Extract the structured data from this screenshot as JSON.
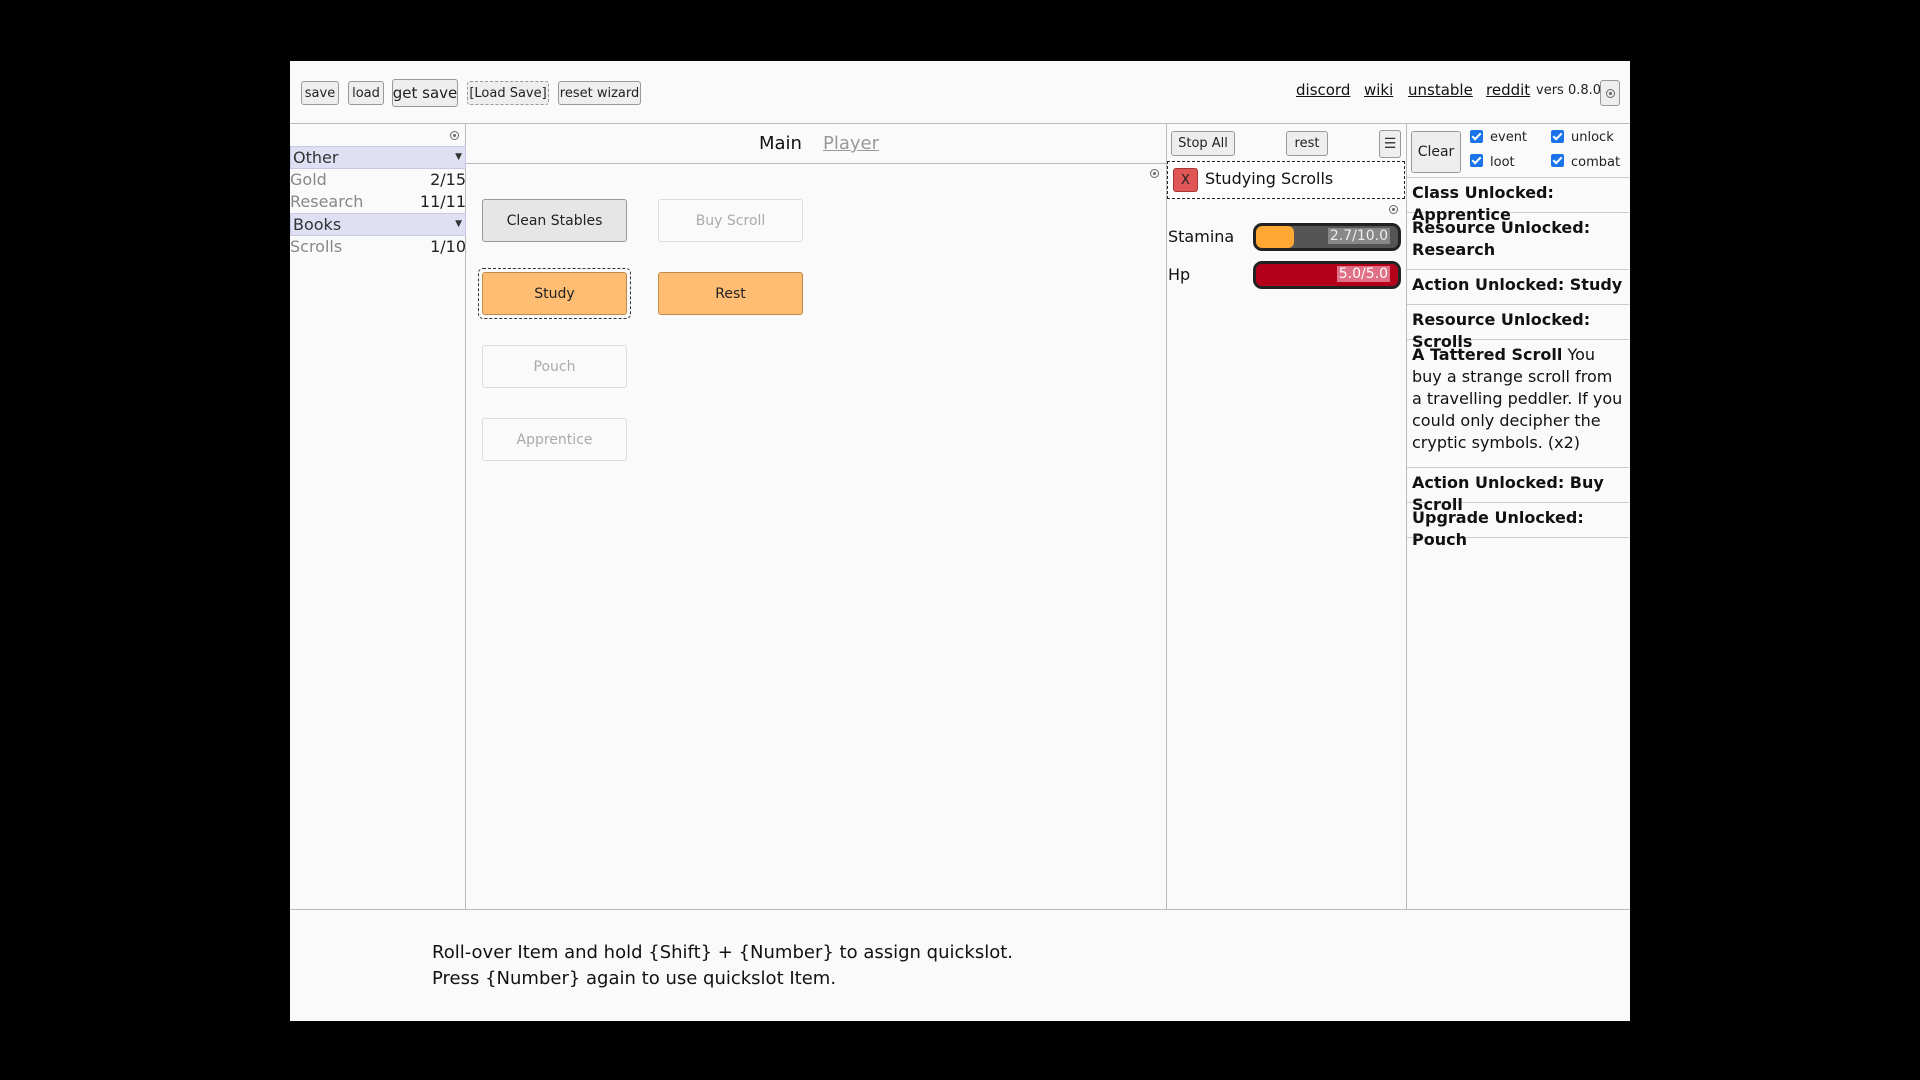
{
  "toolbar": {
    "save": "save",
    "load": "load",
    "get_save": "get save",
    "load_save": "[Load Save]",
    "reset_wizard": "reset wizard"
  },
  "links": {
    "discord": "discord",
    "wiki": "wiki",
    "unstable": "unstable",
    "reddit": "reddit",
    "version": "vers 0.8.0"
  },
  "resources": {
    "groups": [
      {
        "name": "Other",
        "items": [
          {
            "name": "Gold",
            "value": "2/15"
          },
          {
            "name": "Research",
            "value": "11/11"
          }
        ]
      },
      {
        "name": "Books",
        "items": [
          {
            "name": "Scrolls",
            "value": "1/10"
          }
        ]
      }
    ]
  },
  "tabs": {
    "main": "Main",
    "player": "Player"
  },
  "actions": {
    "clean_stables": "Clean Stables",
    "buy_scroll": "Buy Scroll",
    "study": "Study",
    "rest": "Rest",
    "pouch": "Pouch",
    "apprentice": "Apprentice"
  },
  "running": {
    "stop_all": "Stop All",
    "rest": "rest",
    "cancel": "X",
    "current_task": "Studying Scrolls"
  },
  "stats": {
    "stamina": {
      "label": "Stamina",
      "text": "2.7/10.0",
      "fraction": 0.27,
      "color": "#ffa733"
    },
    "hp": {
      "label": "Hp",
      "text": "5.0/5.0",
      "fraction": 1.0,
      "color": "#b5001b"
    }
  },
  "log": {
    "clear": "Clear",
    "filters": {
      "event": "event",
      "unlock": "unlock",
      "loot": "loot",
      "combat": "combat"
    },
    "entries": [
      {
        "title": "Class Unlocked: Apprentice",
        "text": ""
      },
      {
        "title": "Resource Unlocked: Research",
        "text": ""
      },
      {
        "title": "Action Unlocked: Study",
        "text": ""
      },
      {
        "title": "Resource Unlocked: Scrolls",
        "text": ""
      },
      {
        "title": "A Tattered Scroll",
        "text": " You buy a strange scroll from a travelling peddler. If you could only decipher the cryptic symbols. (x2)"
      },
      {
        "title": "Action Unlocked: Buy Scroll",
        "text": ""
      },
      {
        "title": "Upgrade Unlocked: Pouch",
        "text": ""
      }
    ]
  },
  "footer": {
    "line1": "Roll-over Item and hold {Shift} + {Number} to assign quickslot.",
    "line2": "Press {Number} again to use quickslot Item."
  }
}
